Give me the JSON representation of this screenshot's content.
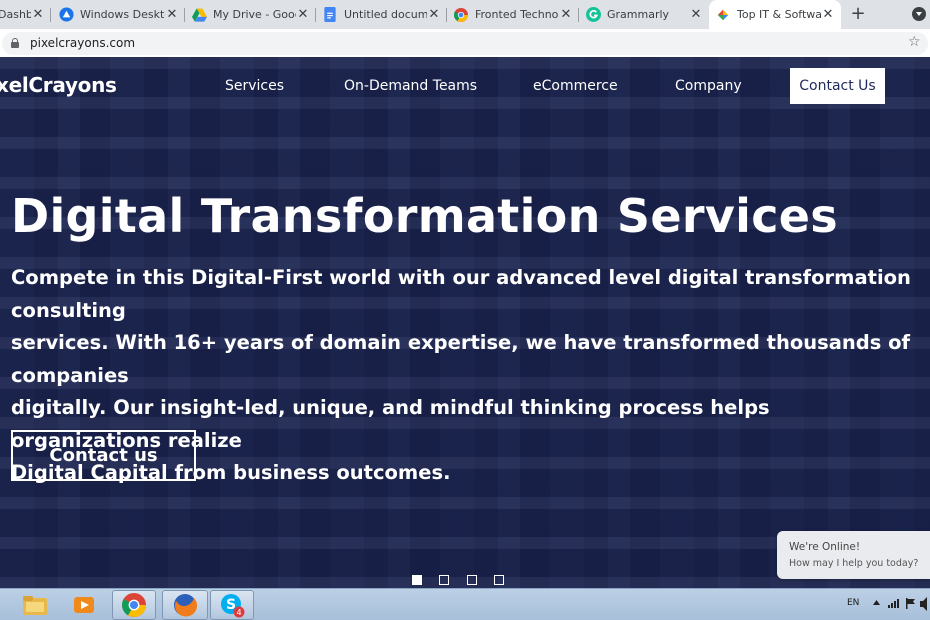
{
  "browser": {
    "tabs": [
      {
        "title": "Dashbo",
        "icon": "dashboard-icon",
        "active": false
      },
      {
        "title": "Windows Desktop",
        "icon": "remote-desktop-icon",
        "active": false
      },
      {
        "title": "My Drive - Google",
        "icon": "google-drive-icon",
        "active": false
      },
      {
        "title": "Untitled document",
        "icon": "google-docs-icon",
        "active": false
      },
      {
        "title": "Fronted Technolog",
        "icon": "google-chrome-icon",
        "active": false
      },
      {
        "title": "Grammarly",
        "icon": "grammarly-icon",
        "active": false
      },
      {
        "title": "Top IT & Software",
        "icon": "pixelcrayons-icon",
        "active": true
      }
    ],
    "close_glyph": "✕",
    "new_tab_glyph": "+",
    "url": "pixelcrayons.com",
    "star_glyph": "☆"
  },
  "site": {
    "logo": "xelCrayons",
    "nav": [
      "Services",
      "On-Demand Teams",
      "eCommerce",
      "Company"
    ],
    "contact_button": "Contact Us",
    "hero": {
      "title": "Digital Transformation Services",
      "lines": [
        "Compete in this Digital-First world with our advanced level digital transformation consulting",
        "services. With 16+ years of domain expertise, we have transformed thousands of companies",
        "digitally. Our insight-led, unique, and mindful thinking process helps organizations realize",
        "Digital Capital from business outcomes."
      ],
      "cta": "Contact us"
    },
    "slider": {
      "count": 4,
      "active": 1
    },
    "chat": {
      "title": "We're Online!",
      "subtitle": "How may I help you today?"
    }
  },
  "taskbar": {
    "apps": [
      "file-explorer-icon",
      "media-player-icon",
      "google-chrome-icon",
      "firefox-icon",
      "skype-icon"
    ],
    "skype_badge": "4",
    "language": "EN"
  },
  "colors": {
    "hero_overlay": "#1b2560",
    "brand_navy": "#1e2a5a",
    "taskbar": "#b4c9e2",
    "chrome_tabstrip": "#dee1e6"
  }
}
